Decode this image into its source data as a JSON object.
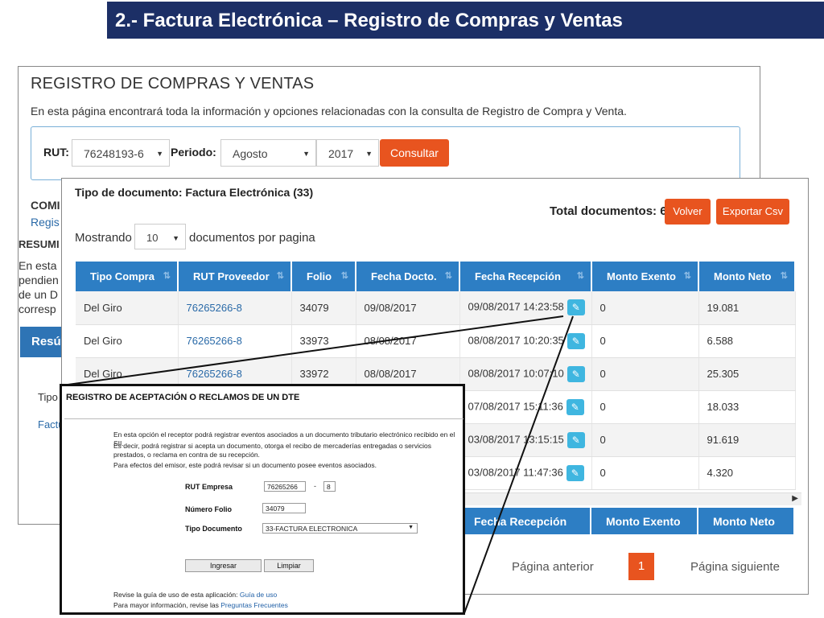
{
  "slide": {
    "title": "2.- Factura Electrónica – Registro de Compras y Ventas"
  },
  "back_page": {
    "title": "REGISTRO DE COMPRAS Y VENTAS",
    "description": "En esta página encontrará toda la información y opciones relacionadas con la consulta de Registro de Compra y Venta.",
    "rut_label": "RUT:",
    "rut_value": "76248193-6",
    "periodo_label": "Periodo:",
    "mes_value": "Agosto",
    "anio_value": "2017",
    "consultar_label": "Consultar",
    "fragments": [
      "COMI",
      "Regis",
      "RESUMI",
      "En esta",
      "pendien",
      "de un D",
      "corresp",
      "Resú",
      "Tipo",
      "Factu"
    ]
  },
  "documents": {
    "doc_type_title": "Tipo de documento: Factura Electrónica (33)",
    "total_label": "Total documentos: 6",
    "volver_label": "Volver",
    "export_label": "Exportar Csv",
    "mostrando_label": "Mostrando",
    "page_size": "10",
    "por_pagina_label": "documentos por pagina",
    "columns": [
      "Tipo Compra",
      "RUT Proveedor",
      "Folio",
      "Fecha Docto.",
      "Fecha Recepción",
      "Monto Exento",
      "Monto Neto"
    ],
    "rows": [
      {
        "tipo": "Del Giro",
        "rut": "76265266-8",
        "folio": "34079",
        "fecha": "09/08/2017",
        "recepcion": "09/08/2017 14:23:58",
        "exento": "0",
        "neto": "19.081"
      },
      {
        "tipo": "Del Giro",
        "rut": "76265266-8",
        "folio": "33973",
        "fecha": "08/08/2017",
        "recepcion": "08/08/2017 10:20:35",
        "exento": "0",
        "neto": "6.588"
      },
      {
        "tipo": "Del Giro",
        "rut": "76265266-8",
        "folio": "33972",
        "fecha": "08/08/2017",
        "recepcion": "08/08/2017 10:07:10",
        "exento": "0",
        "neto": "25.305"
      },
      {
        "tipo": "",
        "rut": "",
        "folio": "",
        "fecha": "",
        "recepcion": "07/08/2017 15:11:36",
        "exento": "0",
        "neto": "18.033"
      },
      {
        "tipo": "",
        "rut": "",
        "folio": "",
        "fecha": "",
        "recepcion": "03/08/2017 13:15:15",
        "exento": "0",
        "neto": "91.619"
      },
      {
        "tipo": "",
        "rut": "",
        "folio": "",
        "fecha": "",
        "recepcion": "03/08/2017 11:47:36",
        "exento": "0",
        "neto": "4.320"
      }
    ],
    "footer_columns": [
      "Fecha Recepción",
      "Monto Exento",
      "Monto Neto"
    ],
    "prev_label": "Página anterior",
    "current_page": "1",
    "next_label": "Página siguiente"
  },
  "popup": {
    "title": "REGISTRO DE ACEPTACIÓN O RECLAMOS DE UN DTE",
    "para1": "En esta opción el receptor podrá registrar eventos asociados a un documento tributario electrónico recibido en el SII.",
    "para2": "Es decir, podrá registrar si acepta un documento, otorga el recibo de mercaderías entregadas o servicios prestados, o reclama en contra de su recepción.",
    "para3": "Para efectos del emisor, este podrá revisar si un documento posee eventos asociados.",
    "rut_empresa_label": "RUT Empresa",
    "rut_empresa_value": "76265266",
    "rut_dash": "-",
    "rut_dv_value": "8",
    "folio_label": "Número Folio",
    "folio_value": "34079",
    "tipo_doc_label": "Tipo Documento",
    "tipo_doc_value": "33-FACTURA ELECTRONICA",
    "ingresar_label": "Ingresar",
    "limpiar_label": "Limpiar",
    "guide_text": "Revise la guía de uso de esta aplicación:",
    "guide_link": "Guía de uso",
    "info_text": "Para mayor información, revise las",
    "info_link": "Preguntas Frecuentes"
  }
}
